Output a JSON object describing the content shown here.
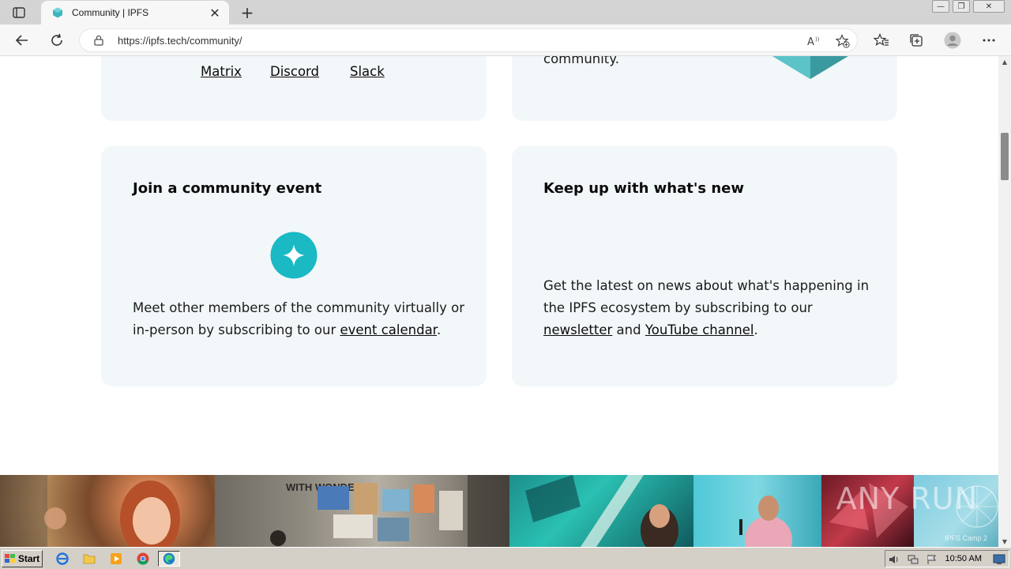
{
  "browser": {
    "tab_title": "Community | IPFS",
    "tab_close": "✕",
    "new_tab": "+",
    "url": "https://ipfs.tech/community/",
    "win_min": "—",
    "win_max": "❐",
    "win_close": "✕"
  },
  "page": {
    "chat_links": [
      "Matrix",
      "Discord",
      "Slack"
    ],
    "top_right_text": "community.",
    "event_card": {
      "title": "Join a community event",
      "text_before": "Meet other members of the community virtually or in-person by subscribing to our ",
      "link": "event calendar",
      "text_after": "."
    },
    "news_card": {
      "title": "Keep up with what's new",
      "text_before": "Get the latest on news about what's happening in the IPFS ecosystem by subscribing to our ",
      "link1": "newsletter",
      "text_mid": " and ",
      "link2": "YouTube channel",
      "text_after": "."
    },
    "photo_text": {
      "wonder": "WITH WONDER",
      "watermark": "ANY RUN",
      "subtext": "IPFS Camp 2"
    },
    "accent_color": "#1ab9c4"
  },
  "taskbar": {
    "start_label": "Start",
    "clock": "10:50 AM"
  }
}
